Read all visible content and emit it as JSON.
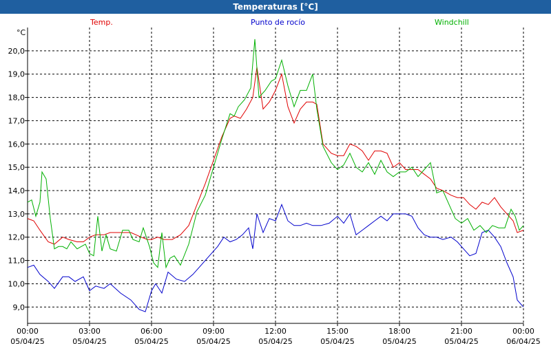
{
  "window": {
    "title": "Temperaturas [°C]"
  },
  "colors": {
    "title_bar": "#1f5fa0",
    "temp": "#e00000",
    "dew_point": "#0000cc",
    "windchill": "#00b000",
    "grid": "#000000"
  },
  "chart_data": {
    "type": "line",
    "title": "Temperaturas [°C]",
    "ylabel": "°C",
    "ylim": [
      8.3,
      21.0
    ],
    "xlim": [
      0,
      24
    ],
    "grid": true,
    "legend_placement": "top",
    "x_ticks": [
      {
        "time": "00:00",
        "date": "05/04/25",
        "x": 0
      },
      {
        "time": "03:00",
        "date": "05/04/25",
        "x": 3
      },
      {
        "time": "06:00",
        "date": "05/04/25",
        "x": 6
      },
      {
        "time": "09:00",
        "date": "05/04/25",
        "x": 9
      },
      {
        "time": "12:00",
        "date": "05/04/25",
        "x": 12
      },
      {
        "time": "15:00",
        "date": "05/04/25",
        "x": 15
      },
      {
        "time": "18:00",
        "date": "05/04/25",
        "x": 18
      },
      {
        "time": "21:00",
        "date": "05/04/25",
        "x": 21
      },
      {
        "time": "00:00",
        "date": "06/04/25",
        "x": 24
      }
    ],
    "y_ticks": [
      "9,0",
      "10,0",
      "11,0",
      "12,0",
      "13,0",
      "14,0",
      "15,0",
      "16,0",
      "17,0",
      "18,0",
      "19,0",
      "20,0"
    ],
    "y_tick_values": [
      9,
      10,
      11,
      12,
      13,
      14,
      15,
      16,
      17,
      18,
      19,
      20
    ],
    "series": [
      {
        "name": "Temp.",
        "color": "#e00000",
        "x": [
          0,
          0.3,
          0.6,
          1,
          1.3,
          1.7,
          2,
          2.4,
          2.7,
          3,
          3.3,
          3.7,
          4,
          4.5,
          5,
          5.5,
          5.8,
          6,
          6.3,
          6.6,
          7,
          7.4,
          7.8,
          8.2,
          8.6,
          9,
          9.4,
          9.8,
          10,
          10.3,
          10.6,
          10.9,
          11.1,
          11.4,
          11.7,
          12,
          12.3,
          12.6,
          12.9,
          13.2,
          13.5,
          13.8,
          14,
          14.3,
          14.7,
          15,
          15.3,
          15.6,
          15.9,
          16.2,
          16.5,
          16.8,
          17.1,
          17.4,
          17.7,
          18,
          18.3,
          18.6,
          18.9,
          19.2,
          19.5,
          19.8,
          20.1,
          20.5,
          20.8,
          21.1,
          21.4,
          21.7,
          22,
          22.3,
          22.6,
          22.9,
          23.2,
          23.5,
          23.7,
          24
        ],
        "values": [
          12.8,
          12.7,
          12.3,
          11.8,
          11.7,
          12.0,
          11.9,
          11.8,
          11.8,
          12.0,
          12.1,
          12.1,
          12.2,
          12.2,
          12.2,
          12.0,
          11.9,
          11.9,
          12.0,
          11.9,
          11.9,
          12.1,
          12.5,
          13.4,
          14.3,
          15.3,
          16.3,
          17.1,
          17.2,
          17.1,
          17.5,
          18.0,
          19.3,
          17.5,
          17.8,
          18.3,
          19.0,
          17.6,
          16.9,
          17.5,
          17.8,
          17.8,
          17.7,
          16.0,
          15.6,
          15.5,
          15.5,
          16.0,
          15.9,
          15.7,
          15.3,
          15.7,
          15.7,
          15.6,
          15.0,
          15.2,
          14.9,
          14.9,
          14.9,
          14.7,
          14.5,
          14.1,
          14.0,
          13.8,
          13.7,
          13.7,
          13.4,
          13.2,
          13.5,
          13.4,
          13.7,
          13.3,
          13.0,
          12.7,
          12.2,
          12.3
        ]
      },
      {
        "name": "Punto de rocío",
        "color": "#0000cc",
        "x": [
          0,
          0.3,
          0.6,
          1,
          1.3,
          1.7,
          2,
          2.3,
          2.7,
          3,
          3.3,
          3.7,
          4,
          4.5,
          5,
          5.4,
          5.7,
          6,
          6.2,
          6.5,
          6.8,
          7.2,
          7.6,
          8,
          8.4,
          8.8,
          9.2,
          9.5,
          9.8,
          10.1,
          10.4,
          10.7,
          10.9,
          11.1,
          11.4,
          11.7,
          12,
          12.3,
          12.6,
          12.9,
          13.2,
          13.5,
          13.8,
          14.2,
          14.6,
          15,
          15.3,
          15.6,
          15.9,
          16.2,
          16.5,
          16.8,
          17.1,
          17.4,
          17.7,
          18,
          18.3,
          18.6,
          18.9,
          19.2,
          19.5,
          19.8,
          20.1,
          20.5,
          20.8,
          21.1,
          21.4,
          21.7,
          22,
          22.3,
          22.6,
          22.9,
          23.2,
          23.5,
          23.7,
          24
        ],
        "values": [
          10.7,
          10.8,
          10.4,
          10.1,
          9.8,
          10.3,
          10.3,
          10.1,
          10.3,
          9.7,
          9.9,
          9.8,
          10.0,
          9.6,
          9.3,
          8.9,
          8.8,
          9.7,
          10.0,
          9.6,
          10.5,
          10.2,
          10.1,
          10.4,
          10.8,
          11.2,
          11.6,
          12.0,
          11.8,
          11.9,
          12.1,
          12.4,
          11.5,
          13.0,
          12.2,
          12.8,
          12.7,
          13.4,
          12.7,
          12.5,
          12.5,
          12.6,
          12.5,
          12.5,
          12.6,
          12.9,
          12.6,
          13.0,
          12.1,
          12.3,
          12.5,
          12.7,
          12.9,
          12.7,
          13.0,
          13.0,
          13.0,
          12.9,
          12.4,
          12.1,
          12.0,
          12.0,
          11.9,
          12.0,
          11.8,
          11.5,
          11.2,
          11.3,
          12.2,
          12.3,
          12.0,
          11.6,
          10.9,
          10.3,
          9.3,
          9.0
        ]
      },
      {
        "name": "Windchill",
        "color": "#00b000",
        "x": [
          0,
          0.2,
          0.4,
          0.6,
          0.7,
          0.9,
          1.1,
          1.3,
          1.5,
          1.7,
          1.9,
          2.1,
          2.4,
          2.6,
          2.8,
          3,
          3.2,
          3.4,
          3.6,
          3.8,
          4,
          4.3,
          4.6,
          4.9,
          5.1,
          5.4,
          5.6,
          5.9,
          6.1,
          6.3,
          6.5,
          6.7,
          6.9,
          7.1,
          7.4,
          7.8,
          8.2,
          8.6,
          9,
          9.4,
          9.8,
          10,
          10.2,
          10.5,
          10.8,
          11,
          11.2,
          11.5,
          11.8,
          12,
          12.3,
          12.6,
          12.9,
          13.2,
          13.5,
          13.8,
          14,
          14.3,
          14.7,
          15,
          15.3,
          15.6,
          15.9,
          16.2,
          16.5,
          16.8,
          17.1,
          17.4,
          17.7,
          18,
          18.3,
          18.6,
          18.9,
          19.2,
          19.5,
          19.8,
          20.1,
          20.4,
          20.7,
          21,
          21.3,
          21.6,
          21.9,
          22.2,
          22.5,
          22.8,
          23.1,
          23.4,
          23.6,
          23.8,
          24
        ],
        "values": [
          13.5,
          13.6,
          12.9,
          13.5,
          14.8,
          14.5,
          12.8,
          11.5,
          11.6,
          11.6,
          11.5,
          11.8,
          11.5,
          11.6,
          11.7,
          11.3,
          11.2,
          12.9,
          11.4,
          12.1,
          11.5,
          11.4,
          12.3,
          12.3,
          11.9,
          11.8,
          12.4,
          11.6,
          10.9,
          10.7,
          12.2,
          10.7,
          11.1,
          11.2,
          10.8,
          11.7,
          13.1,
          13.8,
          15.0,
          16.2,
          17.3,
          17.2,
          17.6,
          17.9,
          18.4,
          20.5,
          18.0,
          18.3,
          18.7,
          18.8,
          19.6,
          18.5,
          17.6,
          18.3,
          18.3,
          19.0,
          17.5,
          15.9,
          15.2,
          14.9,
          15.1,
          15.6,
          15.0,
          14.8,
          15.2,
          14.7,
          15.3,
          14.8,
          14.6,
          14.8,
          14.8,
          15.0,
          14.6,
          14.9,
          15.2,
          13.9,
          14.0,
          13.4,
          12.8,
          12.6,
          12.8,
          12.3,
          12.5,
          12.2,
          12.5,
          12.4,
          12.4,
          13.2,
          12.9,
          12.3,
          12.5
        ]
      }
    ]
  }
}
